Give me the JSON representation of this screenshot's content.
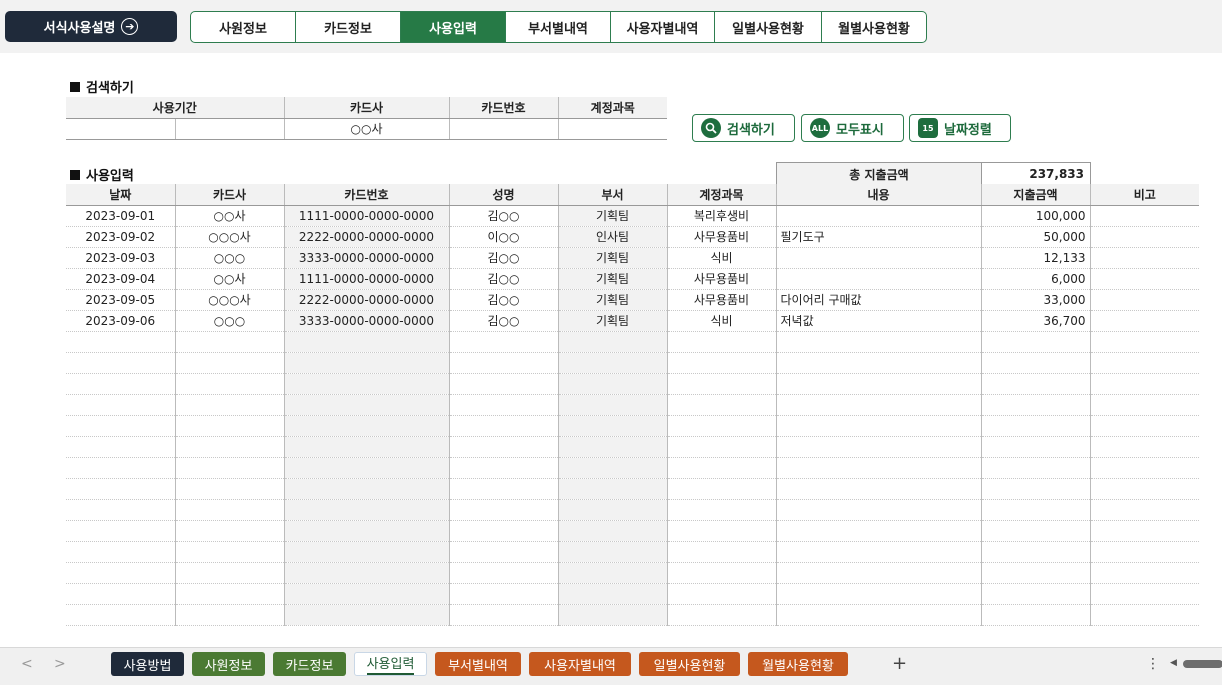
{
  "topbar": {
    "guide_button": "서식사용설명",
    "guide_icon": "arrow-right-circle-icon",
    "tabs": [
      {
        "label": "사원정보",
        "active": false
      },
      {
        "label": "카드정보",
        "active": false
      },
      {
        "label": "사용입력",
        "active": true
      },
      {
        "label": "부서별내역",
        "active": false
      },
      {
        "label": "사용자별내역",
        "active": false
      },
      {
        "label": "일별사용현황",
        "active": false
      },
      {
        "label": "월별사용현황",
        "active": false
      }
    ]
  },
  "search": {
    "title": "검색하기",
    "headers": {
      "period": "사용기간",
      "card_company": "카드사",
      "card_number": "카드번호",
      "account": "계정과목"
    },
    "values": {
      "period_start": "",
      "period_end": "",
      "card_company": "○○사",
      "card_number": "",
      "account": ""
    }
  },
  "actions": {
    "search": {
      "label": "검색하기",
      "icon": "magnifier-icon"
    },
    "show_all": {
      "label": "모두표시",
      "icon": "all-icon",
      "icon_text": "ALL"
    },
    "sort_date": {
      "label": "날짜정렬",
      "icon": "calendar-icon",
      "icon_text": "15"
    }
  },
  "usage": {
    "title": "사용입력",
    "total_label": "총 지출금액",
    "total_value": "237,833",
    "columns": [
      "날짜",
      "카드사",
      "카드번호",
      "성명",
      "부서",
      "계정과목",
      "내용",
      "지출금액",
      "비고"
    ],
    "rows": [
      [
        "2023-09-01",
        "○○사",
        "1111-0000-0000-0000",
        "김○○",
        "기획팀",
        "복리후생비",
        "",
        "100,000",
        ""
      ],
      [
        "2023-09-02",
        "○○○사",
        "2222-0000-0000-0000",
        "이○○",
        "인사팀",
        "사무용품비",
        "필기도구",
        "50,000",
        ""
      ],
      [
        "2023-09-03",
        "○○○",
        "3333-0000-0000-0000",
        "김○○",
        "기획팀",
        "식비",
        "",
        "12,133",
        ""
      ],
      [
        "2023-09-04",
        "○○사",
        "1111-0000-0000-0000",
        "김○○",
        "기획팀",
        "사무용품비",
        "",
        "6,000",
        ""
      ],
      [
        "2023-09-05",
        "○○○사",
        "2222-0000-0000-0000",
        "김○○",
        "기획팀",
        "사무용품비",
        "다이어리 구매값",
        "33,000",
        ""
      ],
      [
        "2023-09-06",
        "○○○",
        "3333-0000-0000-0000",
        "김○○",
        "기획팀",
        "식비",
        "저녁값",
        "36,700",
        ""
      ]
    ],
    "empty_rows": 14
  },
  "sheet_tabs": [
    {
      "label": "사용방법",
      "style": "dark"
    },
    {
      "label": "사원정보",
      "style": "green"
    },
    {
      "label": "카드정보",
      "style": "green"
    },
    {
      "label": "사용입력",
      "style": "current"
    },
    {
      "label": "부서별내역",
      "style": "orange"
    },
    {
      "label": "사용자별내역",
      "style": "orange"
    },
    {
      "label": "일별사용현황",
      "style": "orange"
    },
    {
      "label": "월별사용현황",
      "style": "orange"
    }
  ],
  "icons": {
    "prev": "chevron-left-icon",
    "next": "chevron-right-icon",
    "add": "plus-icon",
    "more": "kebab-icon"
  }
}
